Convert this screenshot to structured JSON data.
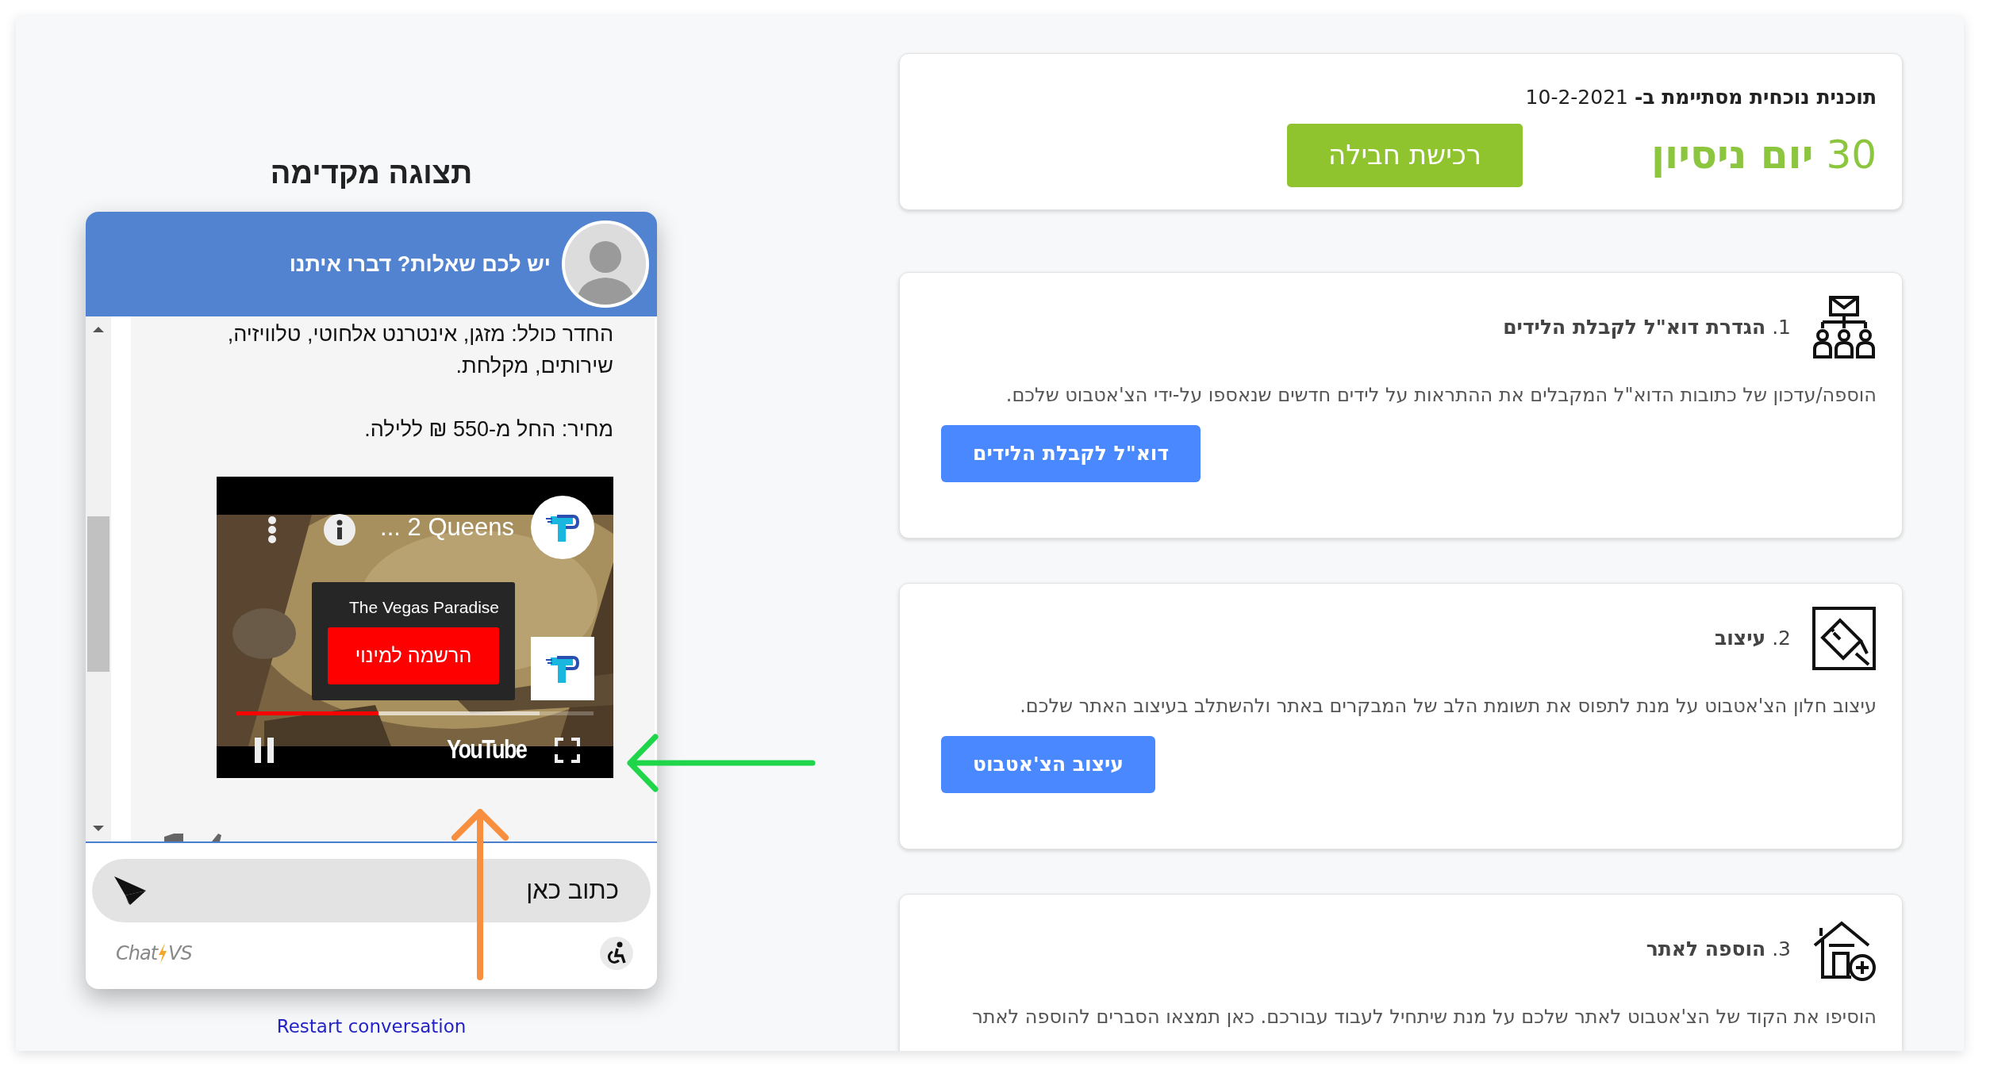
{
  "preview": {
    "title": "תצוגה מקדימה",
    "chat": {
      "header": "יש לכם שאלות? דברו איתנו",
      "messages": [
        {
          "kind": "text",
          "text": "החדר כולל: מזגן, אינטרנט אלחוטי, טלוויזיה, שירותים, מקלחת."
        },
        {
          "kind": "text",
          "text": "מחיר: החל מ-550 ₪ ללילה."
        },
        {
          "kind": "video",
          "title": "... 2 Queens",
          "channel": "The Vegas Paradise",
          "subscribe": "הרשמה למינוי",
          "playing": true,
          "progress": {
            "level": 0.4
          },
          "brand": "YouTube"
        }
      ],
      "input": {
        "placeholder": "כתוב כאן"
      },
      "footer": {
        "brand_start": "Chat",
        "brand_end": "VS"
      }
    },
    "restart": "Restart conversation"
  },
  "plan": {
    "ends": "**תוכנית נוכחית מסתיימת ב-** 10-2-2021",
    "trial": "30 **יום ניסיון**",
    "button": "רכישת חבילה"
  },
  "steps": [
    {
      "kind": "email",
      "title": "1. **הגדרת דוא\"ל לקבלת הלידים**",
      "text": "הוספה/עדכון של כתובות הדוא\"ל המקבלים את ההתראות על לידים חדשים שנאספו על-ידי הצ'אטבוט שלכם.",
      "button": "דוא\"ל לקבלת הלידים"
    },
    {
      "kind": "design",
      "title": "2. **עיצוב**",
      "text": "עיצוב חלון הצ'אטבוט על מנת לתפוס את תשומת הלב של המבקרים באתר ולהשתלב בעיצוב האתר שלכם.",
      "button": "עיצוב הצ'אטבוט"
    },
    {
      "kind": "site",
      "title": "3. **הוספה לאתר**",
      "text": "הוסיפו את הקוד של הצ'אטבוט לאתר שלכם על מנת שיתחיל לעבוד עבורכם. כאן תמצאו הסברים להוספה לאתר"
    }
  ]
}
